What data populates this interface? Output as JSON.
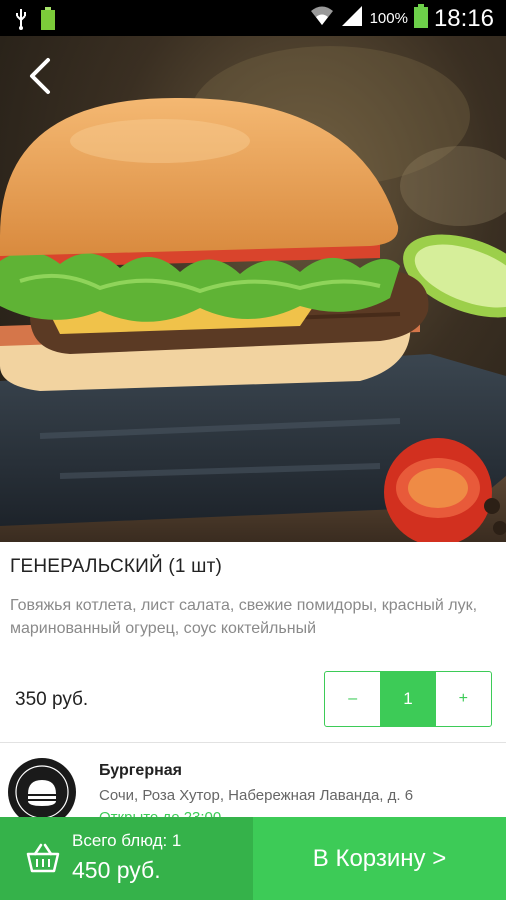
{
  "status_bar": {
    "battery_percent": "100%",
    "time": "18:16",
    "icons": [
      "usb-icon",
      "battery-charging-icon",
      "wifi-icon",
      "signal-icon",
      "battery-icon"
    ]
  },
  "hero": {
    "back_icon": "arrow-left-icon"
  },
  "item": {
    "title": "ГЕНЕРАЛЬСКИЙ (1 шт)",
    "description": "Говяжья котлета, лист салата, свежие помидоры, красный лук, маринованный огурец, соус коктейльный",
    "price": "350 руб.",
    "quantity": "1",
    "minus_label": "–",
    "plus_label": "+"
  },
  "restaurant": {
    "name": "Бургерная",
    "address": "Сочи, Роза Хутор, Набережная Лаванда, д. 6",
    "hours": "Открыто до 23:00"
  },
  "cart": {
    "count_label": "Всего блюд: 1",
    "total": "450 руб.",
    "button_label": "В Корзину >"
  },
  "colors": {
    "accent": "#3dcb57",
    "accent_dark": "#35b24a",
    "status_bar": "#000000"
  }
}
